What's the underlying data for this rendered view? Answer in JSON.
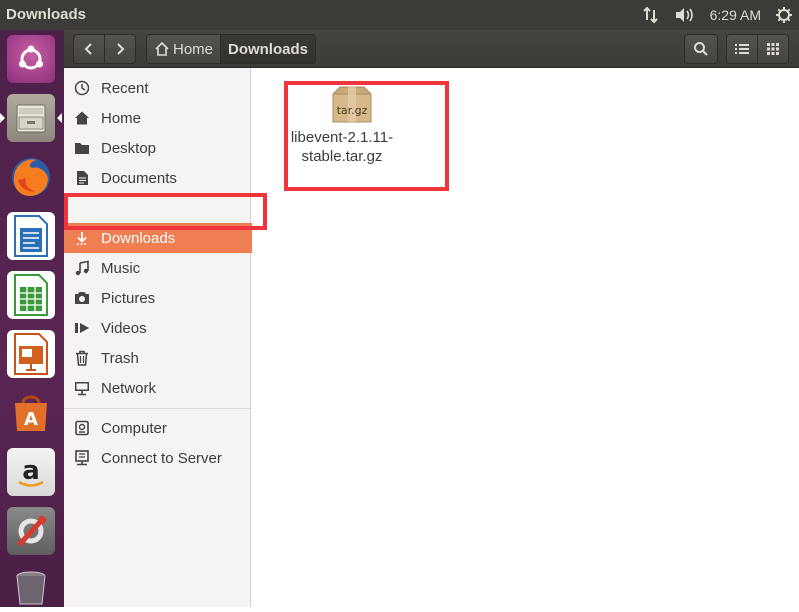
{
  "top_panel": {
    "window_title": "Downloads",
    "time": "6:29 AM",
    "icons": [
      "network-arrows-icon",
      "volume-icon",
      "power-gear-icon"
    ]
  },
  "launcher": {
    "items": [
      "ubuntu-dash-icon",
      "files-icon",
      "firefox-icon",
      "writer-icon",
      "calc-icon",
      "impress-icon",
      "software-center-icon",
      "amazon-icon",
      "system-settings-icon",
      "trash-icon"
    ]
  },
  "headerbar": {
    "path": [
      {
        "label": "Home"
      },
      {
        "label": "Downloads"
      }
    ]
  },
  "sidebar": {
    "items": [
      {
        "label": "Recent",
        "icon": "clock-icon"
      },
      {
        "label": "Home",
        "icon": "home-icon"
      },
      {
        "label": "Desktop",
        "icon": "folder-icon"
      },
      {
        "label": "Documents",
        "icon": "document-icon"
      },
      {
        "label": "Downloads",
        "icon": "download-icon"
      },
      {
        "label": "Music",
        "icon": "music-icon"
      },
      {
        "label": "Pictures",
        "icon": "camera-icon"
      },
      {
        "label": "Videos",
        "icon": "video-icon"
      },
      {
        "label": "Trash",
        "icon": "trash-icon"
      },
      {
        "label": "Network",
        "icon": "network-icon"
      },
      {
        "label": "Computer",
        "icon": "drive-icon"
      },
      {
        "label": "Connect to Server",
        "icon": "server-icon"
      }
    ]
  },
  "content": {
    "files": [
      {
        "name": "libevent-2.1.11-\nstable.tar.gz",
        "icon_label": "tar.gz"
      }
    ]
  },
  "colors": {
    "selection": "#ef7e52",
    "annotation": "#f0343c",
    "panel": "#3c3b37"
  }
}
